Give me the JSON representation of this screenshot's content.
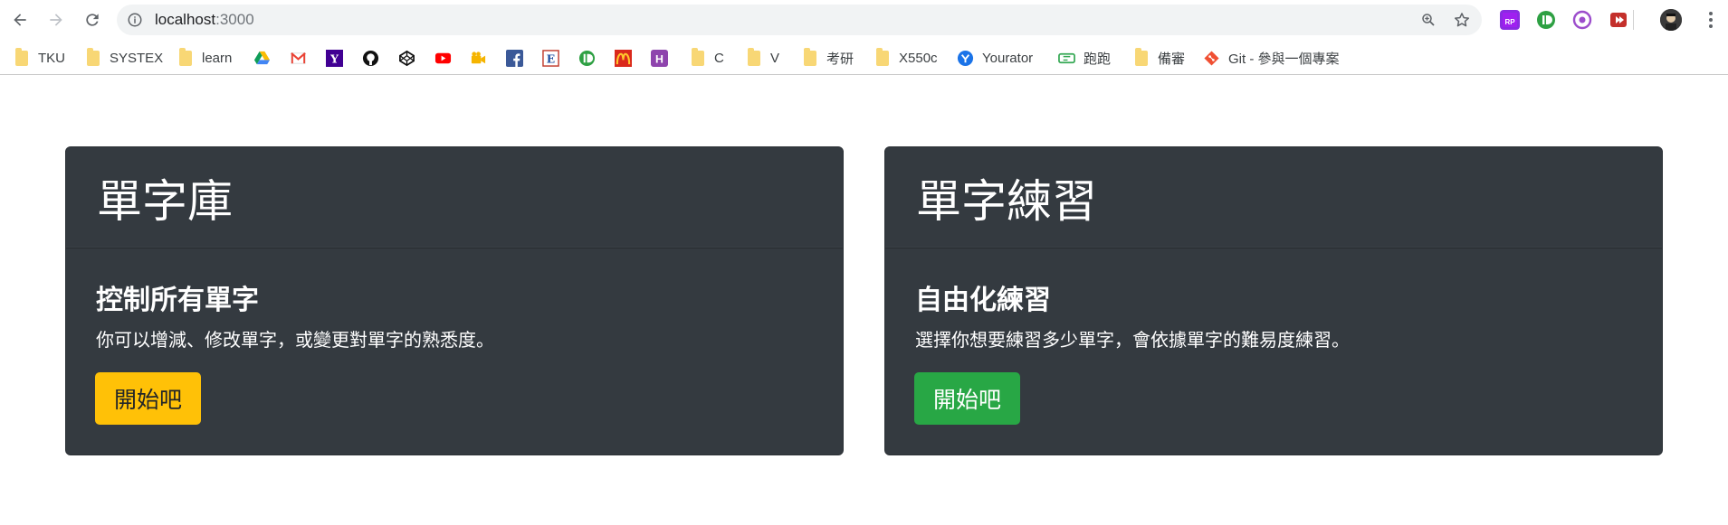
{
  "browser": {
    "url_host": "localhost",
    "url_port": ":3000",
    "icons": {
      "back": "back-arrow-icon",
      "forward": "forward-arrow-icon",
      "reload": "reload-icon",
      "info": "info-icon",
      "zoom": "zoom-icon",
      "star": "star-icon",
      "menu": "more-vert-icon"
    },
    "extensions": [
      "rp-icon",
      "io-icon",
      "cast-icon",
      "youtube-ext-icon"
    ]
  },
  "bookmarks": [
    {
      "label": "TKU",
      "icon": "folder-icon"
    },
    {
      "label": "SYSTEX",
      "icon": "folder-icon"
    },
    {
      "label": "learn",
      "icon": "folder-icon"
    },
    {
      "label": "",
      "icon": "google-drive-icon"
    },
    {
      "label": "",
      "icon": "gmail-icon"
    },
    {
      "label": "",
      "icon": "yahoo-icon"
    },
    {
      "label": "",
      "icon": "github-icon"
    },
    {
      "label": "",
      "icon": "codepen-icon"
    },
    {
      "label": "",
      "icon": "youtube-icon"
    },
    {
      "label": "",
      "icon": "video-icon"
    },
    {
      "label": "",
      "icon": "facebook-icon"
    },
    {
      "label": "",
      "icon": "e-icon"
    },
    {
      "label": "",
      "icon": "io-icon"
    },
    {
      "label": "",
      "icon": "mcdonalds-icon"
    },
    {
      "label": "",
      "icon": "h-icon"
    },
    {
      "label": "C",
      "icon": "folder-icon"
    },
    {
      "label": "V",
      "icon": "folder-icon"
    },
    {
      "label": "考研",
      "icon": "folder-icon"
    },
    {
      "label": "X550c",
      "icon": "folder-icon"
    },
    {
      "label": "Yourator",
      "icon": "yourator-icon"
    },
    {
      "label": "跑跑",
      "icon": "ticket-icon"
    },
    {
      "label": "備審",
      "icon": "folder-icon"
    },
    {
      "label": "Git - 參與一個專案",
      "icon": "git-icon"
    }
  ],
  "cards": [
    {
      "title": "單字庫",
      "subtitle": "控制所有單字",
      "text": "你可以增減、修改單字，或變更對單字的熟悉度。",
      "button": "開始吧",
      "button_color": "#ffc107"
    },
    {
      "title": "單字練習",
      "subtitle": "自由化練習",
      "text": "選擇你想要練習多少單字，會依據單字的難易度練習。",
      "button": "開始吧",
      "button_color": "#28a745"
    }
  ],
  "colors": {
    "card_bg": "#343a40",
    "warning": "#ffc107",
    "success": "#28a745"
  }
}
